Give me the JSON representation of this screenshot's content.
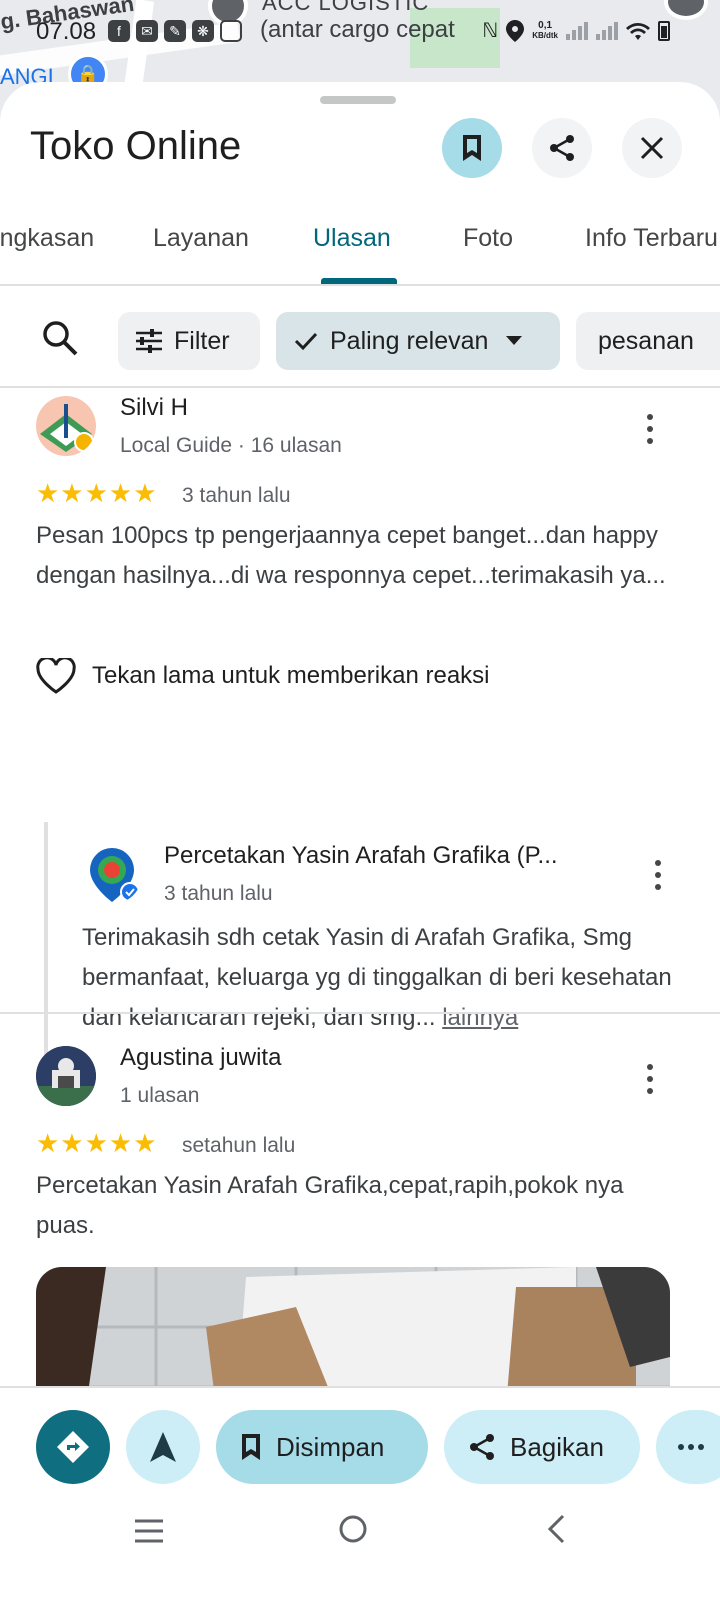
{
  "map": {
    "label_top_left": "g. Bahaswan",
    "label_top_center": "ACC LOGISTIC",
    "label_left": "ANGI"
  },
  "status_bar": {
    "time": "07.08",
    "overlay_text": "(antar cargo cepat",
    "net_speed_value": "0,1",
    "net_speed_unit": "KB/dtk"
  },
  "header": {
    "title": "Toko Online"
  },
  "tabs": [
    {
      "label": "Ringkasan"
    },
    {
      "label": "Layanan"
    },
    {
      "label": "Ulasan"
    },
    {
      "label": "Foto"
    },
    {
      "label": "Info Terbaru"
    }
  ],
  "chips": {
    "filter": "Filter",
    "sort": "Paling relevan",
    "keyword": "pesanan"
  },
  "reviews": [
    {
      "name": "Silvi H",
      "meta": "Local Guide · 16 ulasan",
      "rating": 5,
      "time": "3 tahun lalu",
      "text": "Pesan 100pcs tp pengerjaannya cepet banget...dan happy dengan hasilnya...di wa responnya cepet...terimakasih ya...",
      "reaction_hint": "Tekan lama untuk memberikan reaksi",
      "owner_reply": {
        "name": "Percetakan Yasin Arafah Grafika (P...",
        "time": "3 tahun lalu",
        "text": "Terimakasih sdh cetak Yasin di Arafah Grafika, Smg bermanfaat, keluarga yg di tinggalkan di beri kesehatan dan kelancaran rejeki, dan smg...",
        "more": "lainnya"
      }
    },
    {
      "name": "Agustina juwita",
      "meta": "1 ulasan",
      "rating": 5,
      "time": "setahun lalu",
      "text": "Percetakan Yasin Arafah Grafika,cepat,rapih,pokok nya puas."
    }
  ],
  "action_bar": {
    "saved_label": "Disimpan",
    "share_label": "Bagikan"
  },
  "colors": {
    "accent": "#00677d",
    "star": "#fbbc04",
    "chip_selected": "#d9e4e8",
    "saved_bg": "#a6dbe8"
  }
}
